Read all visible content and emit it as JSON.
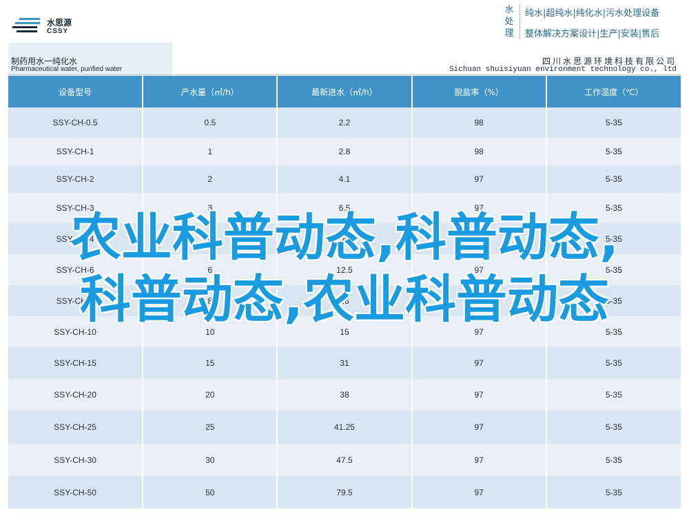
{
  "brand": {
    "name_cn": "水思源",
    "name_latin": "CSSY"
  },
  "slogan": {
    "vertical": [
      "水",
      "处",
      "理"
    ],
    "line1": "纯水|超纯水|纯化水|污水处理设备",
    "line2": "整体解决方案设计|生产|安装|售后"
  },
  "title_band": {
    "left_cn": "制药用水一纯化水",
    "left_en": "Pharmaceutical water, purified water",
    "right_cn": "四川水思源环境科技有限公司",
    "right_en": "Sichuan shuisiyuan environment technology co., ltd"
  },
  "table": {
    "headers": [
      "设备型号",
      "产水量（㎡/h）",
      "最新进水（㎡/h）",
      "脱盐率（%）",
      "工作温度（℃）"
    ],
    "rows": [
      [
        "SSY-CH-0.5",
        "0.5",
        "2.2",
        "98",
        "5-35"
      ],
      [
        "SSY-CH-1",
        "1",
        "2.8",
        "98",
        "5-35"
      ],
      [
        "SSY-CH-2",
        "2",
        "4.1",
        "97",
        "5-35"
      ],
      [
        "SSY-CH-3",
        "3",
        "6.5",
        "97",
        "5-35"
      ],
      [
        "SSY-CH-4",
        "4",
        "8",
        "97",
        "5-35"
      ],
      [
        "SSY-CH-6",
        "6",
        "12.5",
        "97",
        "5-35"
      ],
      [
        "SSY-CH-8",
        "8",
        "16",
        "97",
        "5-35"
      ],
      [
        "SSY-CH-10",
        "10",
        "15",
        "97",
        "5-35"
      ],
      [
        "SSY-CH-15",
        "15",
        "31",
        "97",
        "5-35"
      ],
      [
        "SSY-CH-20",
        "20",
        "38",
        "97",
        "5-35"
      ],
      [
        "SSY-CH-25",
        "25",
        "41.25",
        "97",
        "5-35"
      ],
      [
        "SSY-CH-30",
        "30",
        "47.5",
        "97",
        "5-35"
      ],
      [
        "SSY-CH-50",
        "50",
        "79.5",
        "97",
        "5-35"
      ]
    ]
  },
  "overlay": {
    "line1": "农业科普动态,科普动态,",
    "line2": "科普动态,农业科普动态"
  },
  "colors": {
    "header_blue": "#3f93c8",
    "row_odd": "#d9e5f1",
    "row_even": "#e8eff7",
    "overlay_text": "#1a9be0"
  }
}
